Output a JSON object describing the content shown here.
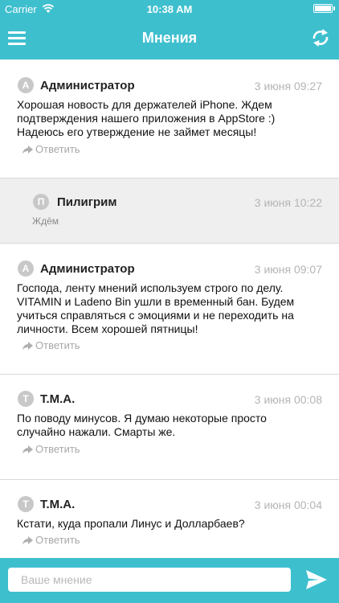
{
  "status": {
    "carrier": "Carrier",
    "time": "10:38 AM"
  },
  "header": {
    "title": "Мнения",
    "menu_icon": "hamburger-menu-icon",
    "refresh_icon": "refresh-icon"
  },
  "posts": [
    {
      "initial": "А",
      "author": "Администратор",
      "date": "3 июня 09:27",
      "lines": [
        "Хорошая новость для держателей iPhone. Ждем",
        "подтверждения нашего приложения в AppStore :)",
        "Надеюсь его утверждение не займет месяцы!"
      ],
      "reply": "Ответить"
    },
    {
      "initial": "П",
      "author": "Пилигрим",
      "date": "3 июня 10:22",
      "lines": [
        "Ждём"
      ]
    },
    {
      "initial": "А",
      "author": "Администратор",
      "date": "3 июня 09:07",
      "lines": [
        "Господа, ленту мнений используем строго по делу.",
        "VITAMIN и Ladeno Bin ушли в временный бан. Будем",
        "учиться справляться с эмоциями и не переходить на",
        "личности. Всем хорошей пятницы!"
      ],
      "reply": "Ответить"
    },
    {
      "initial": "Т",
      "author": "Т.М.А.",
      "date": "3 июня 00:08",
      "lines": [
        "По поводу минусов. Я думаю некоторые просто",
        "случайно нажали. Смарты же."
      ],
      "reply": "Ответить"
    },
    {
      "initial": "Т",
      "author": "Т.М.А.",
      "date": "3 июня 00:04",
      "lines": [
        "Кстати, куда пропали Линус и Долларбаев?"
      ],
      "reply": "Ответить"
    }
  ],
  "composer": {
    "placeholder": "Ваше мнение",
    "value": "",
    "send_icon": "send-icon"
  },
  "colors": {
    "accent": "#3ebfce",
    "reply_background": "#efefef",
    "muted": "#b4b4b4"
  }
}
